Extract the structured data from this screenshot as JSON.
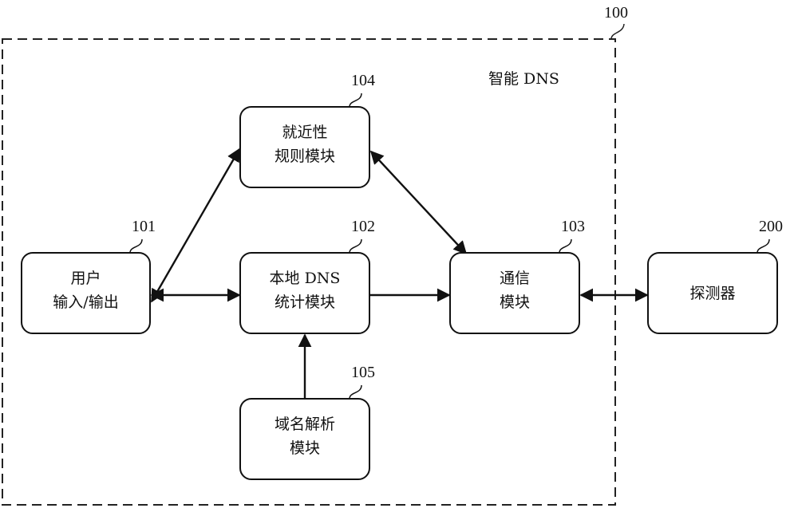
{
  "diagram": {
    "container": {
      "ref": "100",
      "label": "智能 DNS"
    },
    "nodes": [
      {
        "id": "101",
        "ref": "101",
        "lines": [
          "用户",
          "输入/输出"
        ]
      },
      {
        "id": "104",
        "ref": "104",
        "lines": [
          "就近性",
          "规则模块"
        ]
      },
      {
        "id": "102",
        "ref": "102",
        "lines": [
          "本地 DNS",
          "统计模块"
        ]
      },
      {
        "id": "103",
        "ref": "103",
        "lines": [
          "通信",
          "模块"
        ]
      },
      {
        "id": "200",
        "ref": "200",
        "lines": [
          "探测器"
        ]
      },
      {
        "id": "105",
        "ref": "105",
        "lines": [
          "域名解析",
          "模块"
        ]
      }
    ],
    "edges": [
      {
        "from": "101",
        "to": "104",
        "direction": "both"
      },
      {
        "from": "101",
        "to": "102",
        "direction": "both"
      },
      {
        "from": "104",
        "to": "103",
        "direction": "both"
      },
      {
        "from": "102",
        "to": "103",
        "direction": "forward"
      },
      {
        "from": "105",
        "to": "102",
        "direction": "forward"
      },
      {
        "from": "103",
        "to": "200",
        "direction": "both"
      }
    ]
  }
}
